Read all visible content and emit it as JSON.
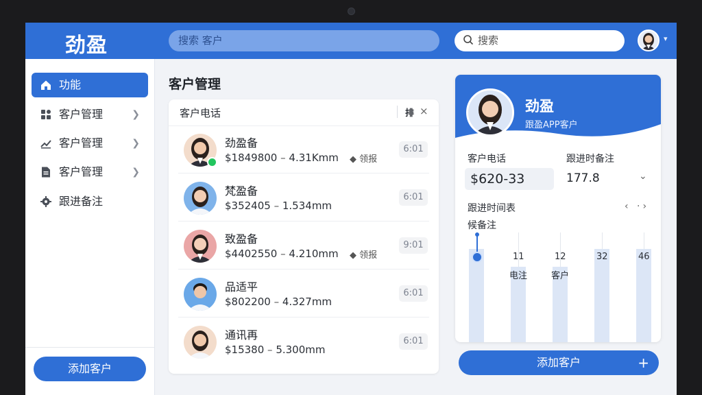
{
  "app": {
    "logo": "劲盈"
  },
  "header": {
    "search_text": "搜索  客户",
    "right_search_placeholder": "搜索"
  },
  "sidebar": {
    "items": [
      {
        "label": "功能",
        "icon": "home-icon",
        "active": true
      },
      {
        "label": "客户管理",
        "icon": "grid-icon"
      },
      {
        "label": "客户管理",
        "icon": "chart-icon"
      },
      {
        "label": "客户管理",
        "icon": "document-icon"
      },
      {
        "label": "跟进备注",
        "icon": "gear-icon"
      }
    ],
    "add_button": "添加客户"
  },
  "main": {
    "title": "客户管理",
    "list_header": "客户电话",
    "list_sort_label": "排",
    "customers": [
      {
        "name": "劲盈备",
        "amount": "$1849800",
        "distance": "4.31Kmm",
        "tag": "领报",
        "time": "6:01",
        "online": true
      },
      {
        "name": "梵盈备",
        "amount": "$352405",
        "distance": "1.534mm",
        "tag": "",
        "time": "6:01",
        "online": false
      },
      {
        "name": "致盈备",
        "amount": "$4402550",
        "distance": "4.210mm",
        "tag": "领报",
        "time": "9:01",
        "online": false
      },
      {
        "name": "品适平",
        "amount": "$802200",
        "distance": "4.327mm",
        "tag": "",
        "time": "6:01",
        "online": false
      },
      {
        "name": "通讯再",
        "amount": "$15380",
        "distance": "5.300mm",
        "tag": "",
        "time": "6:01",
        "online": false
      }
    ]
  },
  "detail": {
    "name": "劲盈",
    "subtitle": "跟盈APP客户",
    "phone_label": "客户电话",
    "phone_value": "$620-33",
    "note_label": "跟进时备注",
    "note_value": "177.8",
    "time_label": "跟进时间表",
    "sub_label": "候备注",
    "ticks": [
      "11",
      "12",
      "32",
      "46"
    ],
    "bar_labels": [
      "电注",
      "客户"
    ],
    "add_button": "添加客户",
    "plus": "+"
  },
  "colors": {
    "accent": "#2f6fd6",
    "online": "#22c55e"
  }
}
